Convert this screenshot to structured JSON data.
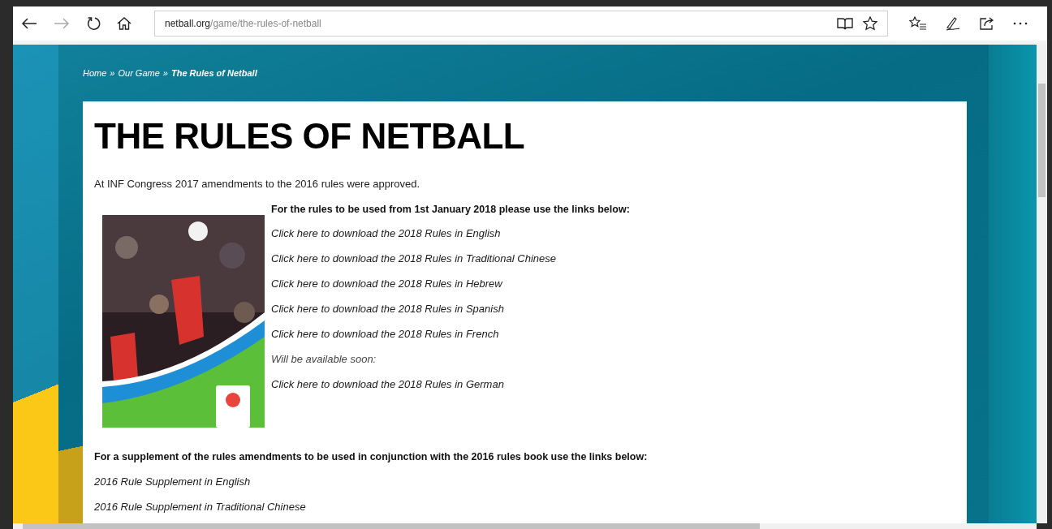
{
  "browser": {
    "back_enabled": true,
    "forward_enabled": false,
    "address": {
      "domain": "netball.org",
      "path": "/game/the-rules-of-netball"
    }
  },
  "breadcrumb": [
    {
      "kind": "link",
      "label": "Home"
    },
    {
      "kind": "separator",
      "label": "»"
    },
    {
      "kind": "link",
      "label": "Our Game"
    },
    {
      "kind": "separator",
      "label": "»"
    },
    {
      "kind": "current",
      "label": "The Rules of Netball"
    }
  ],
  "page": {
    "title": "THE RULES OF NETBALL",
    "intro": "At INF Congress 2017 amendments to the 2016 rules were approved.",
    "rules_heading": "For the rules to be used from 1st January 2018 please use the links below:",
    "rules_links": [
      {
        "kind": "link",
        "text": "Click here to download the 2018 Rules in English"
      },
      {
        "kind": "link",
        "text": "Click here to download the 2018 Rules in Traditional Chinese"
      },
      {
        "kind": "link",
        "text": "Click here to download the 2018 Rules in Hebrew"
      },
      {
        "kind": "link",
        "text": "Click here to download the 2018 Rules in Spanish"
      },
      {
        "kind": "link",
        "text": "Click here to download the 2018 Rules in French"
      },
      {
        "kind": "note",
        "text": "Will be available soon:"
      },
      {
        "kind": "link",
        "text": "Click here to download the 2018 Rules in German"
      }
    ],
    "supplement_heading": "For a supplement of the rules amendments to be used in conjunction with the 2016 rules book use the links below:",
    "supplement_links": [
      "2016 Rule Supplement in English",
      "2016 Rule Supplement in Traditional Chinese"
    ]
  }
}
